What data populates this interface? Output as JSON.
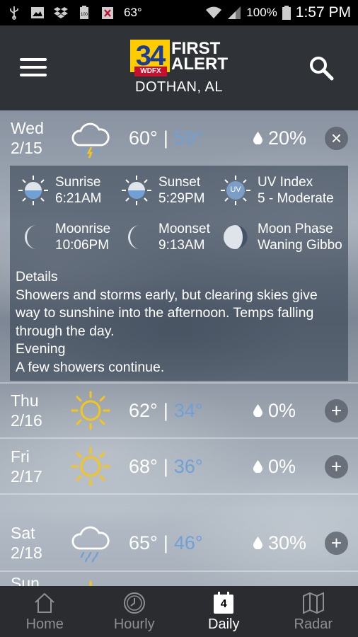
{
  "status_bar": {
    "temperature": "63°",
    "battery": "100%",
    "time": "1:57 PM",
    "icons": [
      "usb-icon",
      "image-icon",
      "dropbox-icon",
      "battery-100-icon",
      "no-sim-icon",
      "wifi-icon",
      "signal-icon",
      "battery-icon"
    ]
  },
  "header": {
    "logo_number": "34",
    "logo_sub": "WDFX",
    "logo_line1": "FIRST",
    "logo_line2": "ALERT",
    "location": "DOTHAN, AL"
  },
  "expanded_day": {
    "day": "Wed",
    "date": "2/15",
    "icon": "thunderstorm-cloud-icon",
    "high": "60°",
    "low": "59°",
    "separator": "|",
    "precip": "20%",
    "toggle": "×",
    "astro": {
      "sunrise_label": "Sunrise",
      "sunrise_value": "6:21AM",
      "sunset_label": "Sunset",
      "sunset_value": "5:29PM",
      "uv_label": "UV Index",
      "uv_value": "5 - Moderate",
      "uv_icon_text": "UV",
      "moonrise_label": "Moonrise",
      "moonrise_value": "10:06PM",
      "moonset_label": "Moonset",
      "moonset_value": "9:13AM",
      "moonphase_label": "Moon Phase",
      "moonphase_value": "Waning Gibbo"
    },
    "details_heading": "Details",
    "details_text": "Showers and storms early, but clearing skies give way to sunshine into the afternoon. Temps falling through the day.",
    "evening_heading": "Evening",
    "evening_text": "A few showers continue."
  },
  "days": [
    {
      "day": "Thu",
      "date": "2/16",
      "icon": "sun-icon",
      "high": "62°",
      "low": "34°",
      "precip": "0%",
      "toggle": "+"
    },
    {
      "day": "Fri",
      "date": "2/17",
      "icon": "sun-icon",
      "high": "68°",
      "low": "36°",
      "precip": "0%",
      "toggle": "+"
    },
    {
      "day": "Sat",
      "date": "2/18",
      "icon": "rain-cloud-icon",
      "high": "65°",
      "low": "46°",
      "precip": "30%",
      "toggle": "+"
    },
    {
      "day": "Sun"
    }
  ],
  "nav": {
    "home": "Home",
    "hourly": "Hourly",
    "daily": "Daily",
    "daily_icon_number": "4",
    "radar": "Radar"
  },
  "colors": {
    "low_temp": "#6fa0d6",
    "sun": "#f5c518",
    "header_bg": "#2f3337",
    "nav_bg": "#2a2c2f"
  }
}
